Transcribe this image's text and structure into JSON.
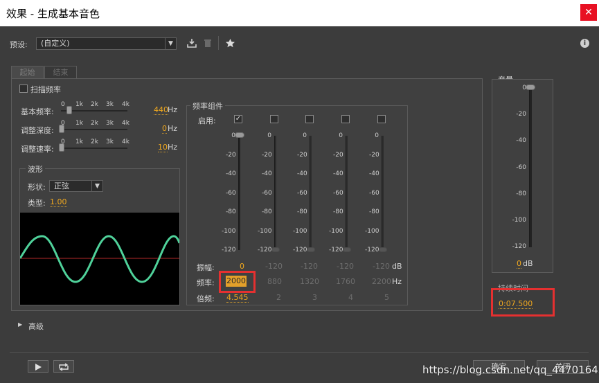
{
  "window": {
    "title": "效果 - 生成基本音色",
    "close_glyph": "✕"
  },
  "preset": {
    "label": "预设:",
    "value": "(自定义)"
  },
  "icons": {
    "save": "save-preset-icon",
    "delete": "trash-icon",
    "favorite": "star-icon",
    "info": "info-icon"
  },
  "tabs": [
    {
      "label": "起始",
      "active": true
    },
    {
      "label": "结束",
      "active": false
    }
  ],
  "sweep": {
    "label": "扫描频率",
    "checked": false
  },
  "top_scale": [
    "0",
    "1k",
    "2k",
    "3k",
    "4k"
  ],
  "base_freq": {
    "label": "基本频率:",
    "value": "440",
    "unit": "Hz",
    "level": 0.11
  },
  "mod_depth": {
    "label": "调整深度:",
    "value": "0",
    "unit": "Hz",
    "level": 0
  },
  "mod_rate": {
    "label": "调整速率:",
    "value": "10",
    "unit": "Hz",
    "level": 0
  },
  "waveform": {
    "group": "波形",
    "shape_label": "形状:",
    "shape_value": "正弦",
    "type_label": "类型:",
    "type_value": "1.00"
  },
  "components": {
    "group": "频率组件",
    "enable_label": "启用:",
    "scale": [
      "0",
      "-20",
      "-40",
      "-60",
      "-80",
      "-100",
      "-120"
    ],
    "amp_label": "振幅:",
    "amp_unit": "dB",
    "freq_label": "频率:",
    "freq_unit": "Hz",
    "mult_label": "倍频:",
    "columns": [
      {
        "enabled": true,
        "amp": "0",
        "freq": "2000",
        "mult": "4.545"
      },
      {
        "enabled": false,
        "amp": "-120",
        "freq": "880",
        "mult": "2"
      },
      {
        "enabled": false,
        "amp": "-120",
        "freq": "1320",
        "mult": "3"
      },
      {
        "enabled": false,
        "amp": "-120",
        "freq": "1760",
        "mult": "4"
      },
      {
        "enabled": false,
        "amp": "-120",
        "freq": "2200",
        "mult": "5"
      }
    ]
  },
  "volume": {
    "label": "音量",
    "scale": [
      "0",
      "-20",
      "-40",
      "-60",
      "-80",
      "-100",
      "-120"
    ],
    "value": "0",
    "unit": "dB"
  },
  "duration": {
    "label": "持续时间",
    "value": "0:07.500"
  },
  "advanced": {
    "label": "高级"
  },
  "footer": {
    "ok": "确定",
    "cancel": "关闭",
    "watermark": "https://blog.csdn.net/qq_44701643"
  },
  "colors": {
    "accent": "#f0a81e",
    "wave": "#4fd19a",
    "zero_line": "#b52a2a",
    "highlight": "#e53030"
  }
}
